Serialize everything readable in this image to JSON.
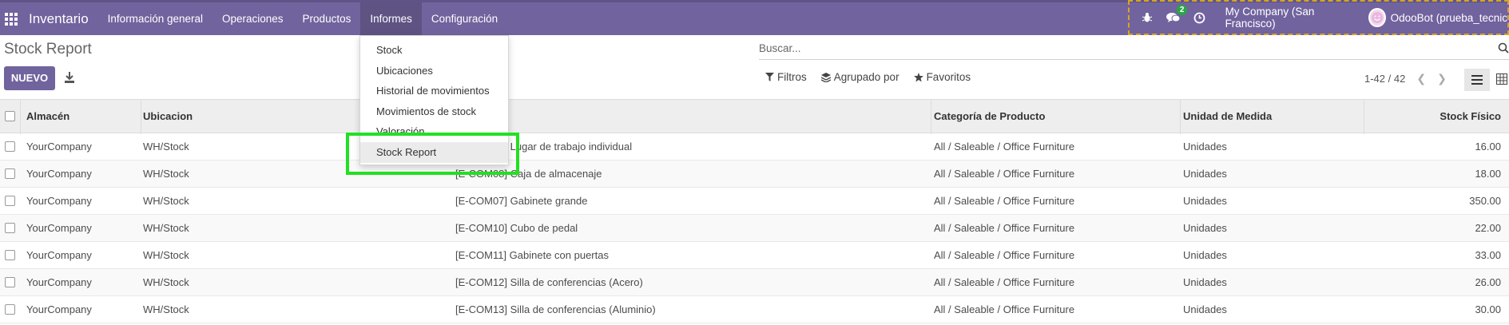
{
  "navbar": {
    "brand": "Inventario",
    "menus": [
      "Información general",
      "Operaciones",
      "Productos",
      "Informes",
      "Configuración"
    ],
    "active_menu": "Informes",
    "messages_badge": "2",
    "company": "My Company (San Francisco)",
    "user": "OdooBot (prueba_tecnic"
  },
  "control": {
    "breadcrumb": "Stock Report",
    "new_label": "NUEVO",
    "search_placeholder": "Buscar...",
    "filters_label": "Filtros",
    "groupby_label": "Agrupado por",
    "favorites_label": "Favoritos",
    "pager": "1-42 / 42"
  },
  "dropdown": {
    "items": [
      "Stock",
      "Ubicaciones",
      "Historial de movimientos",
      "Movimientos de stock",
      "Valoración",
      "Stock Report"
    ],
    "highlighted": "Stock Report"
  },
  "table": {
    "headers": [
      "Almacén",
      "Ubicacion",
      "Categoría de Producto",
      "Unidad de Medida",
      "Stock Físico"
    ],
    "rows": [
      [
        "YourCompany",
        "WH/Stock",
        "[E-COM09] Lugar de trabajo individual",
        "All / Saleable / Office Furniture",
        "Unidades",
        "16.00"
      ],
      [
        "YourCompany",
        "WH/Stock",
        "[E-COM08] Caja de almacenaje",
        "All / Saleable / Office Furniture",
        "Unidades",
        "18.00"
      ],
      [
        "YourCompany",
        "WH/Stock",
        "[E-COM07] Gabinete grande",
        "All / Saleable / Office Furniture",
        "Unidades",
        "350.00"
      ],
      [
        "YourCompany",
        "WH/Stock",
        "[E-COM10] Cubo de pedal",
        "All / Saleable / Office Furniture",
        "Unidades",
        "22.00"
      ],
      [
        "YourCompany",
        "WH/Stock",
        "[E-COM11] Gabinete con puertas",
        "All / Saleable / Office Furniture",
        "Unidades",
        "33.00"
      ],
      [
        "YourCompany",
        "WH/Stock",
        "[E-COM12] Silla de conferencias (Acero)",
        "All / Saleable / Office Furniture",
        "Unidades",
        "26.00"
      ],
      [
        "YourCompany",
        "WH/Stock",
        "[E-COM13] Silla de conferencias (Aluminio)",
        "All / Saleable / Office Furniture",
        "Unidades",
        "30.00"
      ]
    ]
  },
  "colors": {
    "brand": "#71639e",
    "highlight": "#22e022",
    "badge": "#28a745"
  }
}
